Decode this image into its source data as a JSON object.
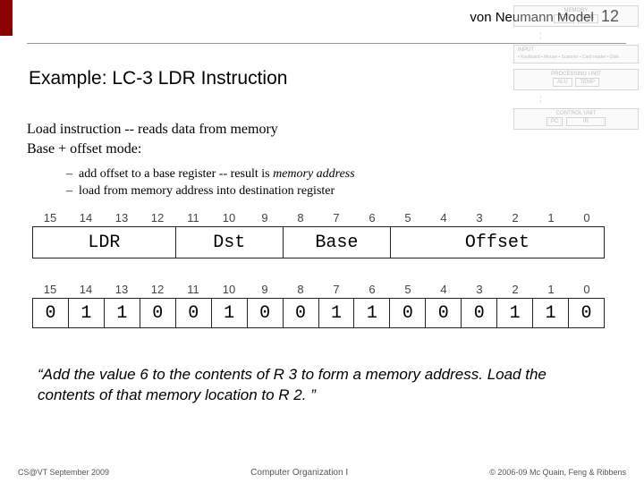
{
  "header": {
    "model": "von Neumann Model",
    "page": "12"
  },
  "title": "Example: LC-3 LDR Instruction",
  "intro": {
    "line1": "Load instruction -- reads data from memory",
    "line2": "Base + offset mode:"
  },
  "bullets": [
    {
      "text_a": "add offset to a base register -- result is ",
      "em": "memory address"
    },
    {
      "text_a": "load from memory address into destination register",
      "em": ""
    }
  ],
  "bitnums": [
    "15",
    "14",
    "13",
    "12",
    "11",
    "10",
    "9",
    "8",
    "7",
    "6",
    "5",
    "4",
    "3",
    "2",
    "1",
    "0"
  ],
  "fields": {
    "opcode": "LDR",
    "dst": "Dst",
    "base": "Base",
    "offset": "Offset"
  },
  "bitvalues": [
    "0",
    "1",
    "1",
    "0",
    "0",
    "1",
    "0",
    "0",
    "1",
    "1",
    "0",
    "0",
    "0",
    "1",
    "1",
    "0"
  ],
  "quote": "“Add the value 6 to the contents of R 3 to form a memory address.  Load the contents of that memory location to R 2. ”",
  "footer": {
    "left": "CS@VT September 2009",
    "mid": "Computer Organization I",
    "right": "© 2006-09  Mc Quain, Feng & Ribbens"
  },
  "diagram": {
    "mem": "MEMORY",
    "mar": "MAR",
    "mdr": "MDR",
    "input": "INPUT",
    "input_items": "• Keyboard\n• Mouse\n• Scanner\n• Card reader\n• Disk",
    "pu": "PROCESSING UNIT",
    "alu": "ALU",
    "temp": "TEMP",
    "cu": "CONTROL UNIT",
    "pc": "PC",
    "ir": "IR"
  }
}
